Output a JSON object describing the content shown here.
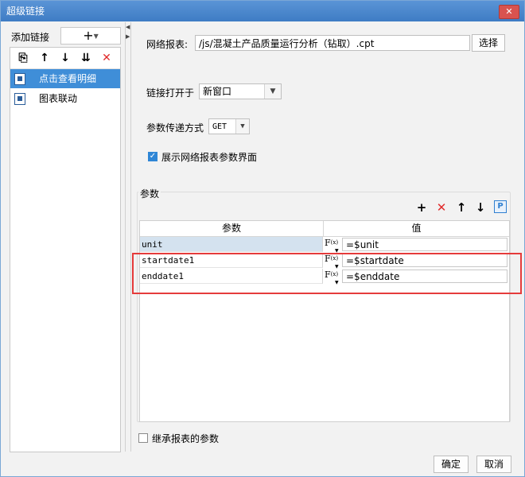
{
  "window": {
    "title": "超级链接",
    "close_glyph": "✕"
  },
  "left": {
    "add_label": "添加链接",
    "add_button_glyph": "+",
    "toolbar": [
      {
        "name": "copy-icon",
        "glyph": "⎘"
      },
      {
        "name": "arrow-up-icon",
        "glyph": "↑"
      },
      {
        "name": "arrow-down-icon",
        "glyph": "↓"
      },
      {
        "name": "move-bottom-icon",
        "glyph": "⇊"
      },
      {
        "name": "delete-icon",
        "glyph": "✕",
        "color": "#e02b2b"
      }
    ],
    "links": [
      {
        "label": "点击查看明细",
        "selected": true
      },
      {
        "label": "图表联动",
        "selected": false
      }
    ]
  },
  "form": {
    "report_label": "网络报表:",
    "report_value": "/js/混凝土产品质量运行分析（钻取）.cpt",
    "choose_button": "选择",
    "open_in_label": "链接打开于",
    "open_in_value": "新窗口",
    "method_label": "参数传递方式",
    "method_value": "GET",
    "show_params_label": "展示网络报表参数界面",
    "show_params_checked": true,
    "params_group_label": "参数",
    "inherit_label": "继承报表的参数",
    "inherit_checked": false
  },
  "params_table": {
    "headers": [
      "参数",
      "值"
    ],
    "rows": [
      {
        "name": "unit",
        "value": "=$unit",
        "selected": true
      },
      {
        "name": "startdate1",
        "value": "=$startdate",
        "selected": false
      },
      {
        "name": "enddate1",
        "value": "=$enddate",
        "selected": false
      }
    ]
  },
  "buttons": {
    "ok": "确定",
    "cancel": "取消"
  },
  "colors": {
    "accent": "#3f8ed8",
    "highlight": "#e53b3b",
    "delete": "#e02b2b"
  }
}
